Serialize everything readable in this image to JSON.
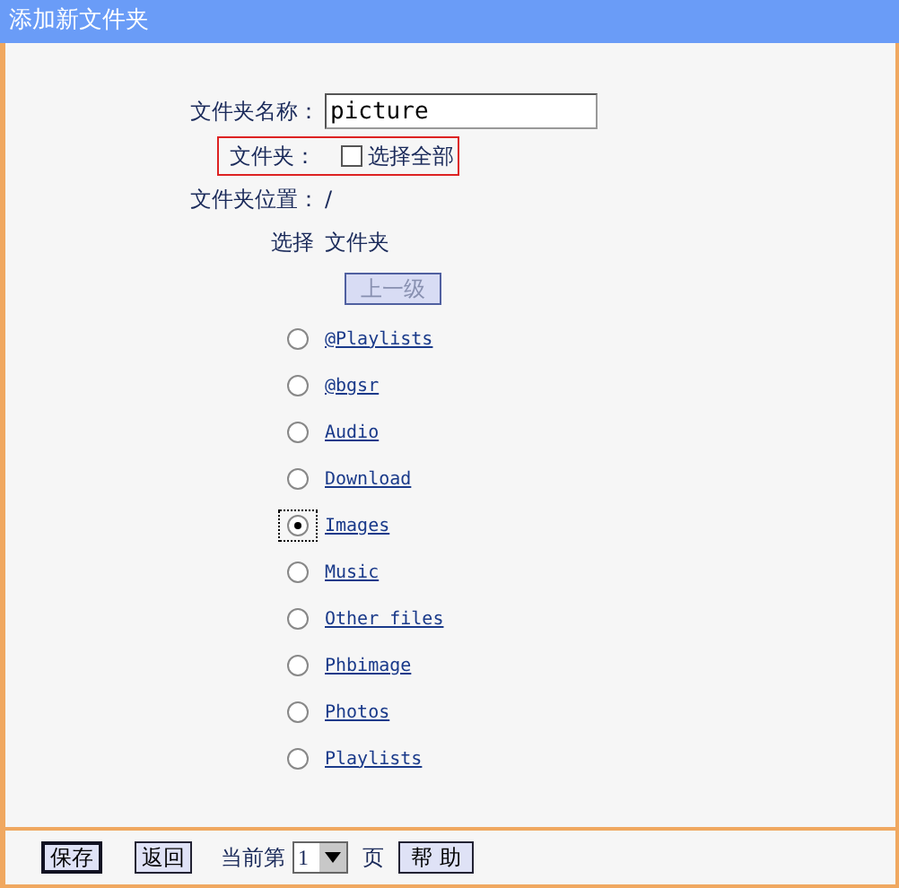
{
  "window": {
    "title": "添加新文件夹"
  },
  "form": {
    "name_label": "文件夹名称：",
    "name_value": "picture",
    "folder_label": "文件夹：",
    "select_all": {
      "label": "选择全部",
      "checked": false
    },
    "location_label": "文件夹位置：",
    "location_value": "/"
  },
  "list_header": {
    "column_1": "选择",
    "column_2": "文件夹"
  },
  "up_button": {
    "label": "上一级",
    "disabled": true
  },
  "folders": [
    {
      "name": "@Playlists",
      "selected": false
    },
    {
      "name": "@bgsr",
      "selected": false
    },
    {
      "name": "Audio",
      "selected": false
    },
    {
      "name": "Download",
      "selected": false
    },
    {
      "name": "Images",
      "selected": true
    },
    {
      "name": "Music",
      "selected": false
    },
    {
      "name": "Other files",
      "selected": false
    },
    {
      "name": "Phbimage",
      "selected": false
    },
    {
      "name": "Photos",
      "selected": false
    },
    {
      "name": "Playlists",
      "selected": false
    }
  ],
  "footer": {
    "save": "保存",
    "back": "返回",
    "page_prefix": "当前第",
    "page_value": "1",
    "page_suffix": "页",
    "help": "帮 助"
  }
}
